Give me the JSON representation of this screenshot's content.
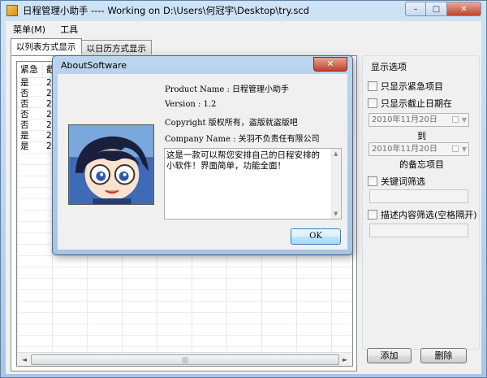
{
  "window": {
    "title": "日程管理小助手 ----  Working on D:\\Users\\何冠宇\\Desktop\\try.scd",
    "minimize_glyph": "–",
    "maximize_glyph": "□",
    "close_glyph": "✕"
  },
  "menubar": {
    "items": [
      "菜单(M)",
      "工具"
    ]
  },
  "tabs": [
    "以列表方式显示",
    "以日历方式显示"
  ],
  "list": {
    "columns": [
      "紧急",
      "截",
      "",
      "",
      "",
      "",
      "",
      "",
      "",
      ""
    ],
    "rows": [
      [
        "是",
        "20"
      ],
      [
        "否",
        "20"
      ],
      [
        "否",
        "20"
      ],
      [
        "否",
        "20"
      ],
      [
        "否",
        "20"
      ],
      [
        "是",
        "20"
      ],
      [
        "是",
        "20"
      ]
    ],
    "scroll_left": "◄",
    "scroll_right": "►",
    "scroll_grip": "|||"
  },
  "options": {
    "title": "显示选项",
    "urgent_only": "只显示紧急项目",
    "deadline_only": "只显示截止日期在",
    "date_from": "2010年11月20日",
    "to_label": "到",
    "date_to": "2010年11月20日",
    "memo_suffix": "的备忘项目",
    "keyword_filter": "关键词筛选",
    "desc_filter": "描述内容筛选(空格隔开)",
    "add_button": "添加",
    "delete_button": "删除"
  },
  "dialog": {
    "title": "AboutSoftware",
    "close_glyph": "✕",
    "product_name": "Product Name : 日程管理小助手",
    "version": "Version :  1.2",
    "copyright": "Copyright 版权所有，盗版就盗版吧",
    "company": "Company Name :  关羽不负责任有限公司",
    "description": "这是一款可以帮您安排自己的日程安排的小软件！界面简单，功能全面！",
    "ok_button": "OK",
    "scroll_up": "▲",
    "scroll_down": "▼"
  }
}
